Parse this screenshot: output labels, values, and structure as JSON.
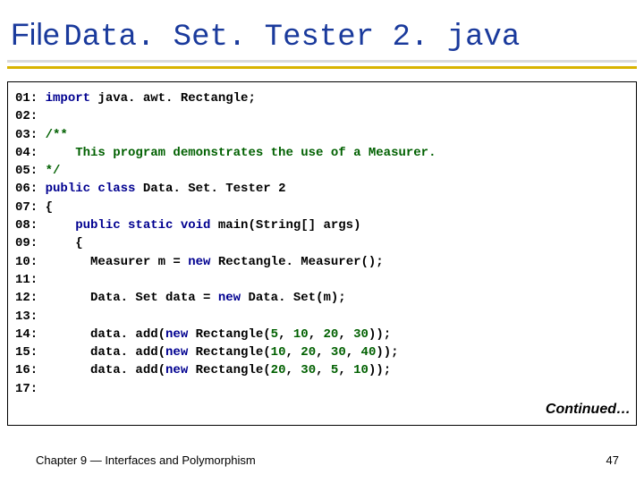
{
  "title": {
    "prefix": "File",
    "filename": " Data. Set. Tester 2. java"
  },
  "code": {
    "lines": [
      {
        "ln": "01:",
        "tokens": [
          {
            "cls": "tok-kw",
            "t": "import"
          },
          {
            "cls": "tok-plain",
            "t": " java. awt. Rectangle;"
          }
        ]
      },
      {
        "ln": "02:",
        "tokens": []
      },
      {
        "ln": "03:",
        "tokens": [
          {
            "cls": "tok-comment",
            "t": "/**"
          }
        ]
      },
      {
        "ln": "04:",
        "tokens": [
          {
            "cls": "tok-comment",
            "t": "    This program demonstrates the use of a Measurer."
          }
        ]
      },
      {
        "ln": "05:",
        "tokens": [
          {
            "cls": "tok-comment",
            "t": "*/"
          }
        ]
      },
      {
        "ln": "06:",
        "tokens": [
          {
            "cls": "tok-kw",
            "t": "public class"
          },
          {
            "cls": "tok-plain",
            "t": " Data. Set. Tester 2"
          }
        ]
      },
      {
        "ln": "07:",
        "tokens": [
          {
            "cls": "tok-plain",
            "t": "{"
          }
        ]
      },
      {
        "ln": "08:",
        "tokens": [
          {
            "cls": "tok-plain",
            "t": "    "
          },
          {
            "cls": "tok-kw",
            "t": "public static void"
          },
          {
            "cls": "tok-plain",
            "t": " main(String[] args)"
          }
        ]
      },
      {
        "ln": "09:",
        "tokens": [
          {
            "cls": "tok-plain",
            "t": "    {"
          }
        ]
      },
      {
        "ln": "10:",
        "tokens": [
          {
            "cls": "tok-plain",
            "t": "      Measurer m = "
          },
          {
            "cls": "tok-kw",
            "t": "new"
          },
          {
            "cls": "tok-plain",
            "t": " Rectangle. Measurer();"
          }
        ]
      },
      {
        "ln": "11:",
        "tokens": []
      },
      {
        "ln": "12:",
        "tokens": [
          {
            "cls": "tok-plain",
            "t": "      Data. Set data = "
          },
          {
            "cls": "tok-kw",
            "t": "new"
          },
          {
            "cls": "tok-plain",
            "t": " Data. Set(m);"
          }
        ]
      },
      {
        "ln": "13:",
        "tokens": []
      },
      {
        "ln": "14:",
        "tokens": [
          {
            "cls": "tok-plain",
            "t": "      data. add("
          },
          {
            "cls": "tok-kw",
            "t": "new"
          },
          {
            "cls": "tok-plain",
            "t": " Rectangle("
          },
          {
            "cls": "tok-num",
            "t": "5"
          },
          {
            "cls": "tok-plain",
            "t": ", "
          },
          {
            "cls": "tok-num",
            "t": "10"
          },
          {
            "cls": "tok-plain",
            "t": ", "
          },
          {
            "cls": "tok-num",
            "t": "20"
          },
          {
            "cls": "tok-plain",
            "t": ", "
          },
          {
            "cls": "tok-num",
            "t": "30"
          },
          {
            "cls": "tok-plain",
            "t": "));"
          }
        ]
      },
      {
        "ln": "15:",
        "tokens": [
          {
            "cls": "tok-plain",
            "t": "      data. add("
          },
          {
            "cls": "tok-kw",
            "t": "new"
          },
          {
            "cls": "tok-plain",
            "t": " Rectangle("
          },
          {
            "cls": "tok-num",
            "t": "10"
          },
          {
            "cls": "tok-plain",
            "t": ", "
          },
          {
            "cls": "tok-num",
            "t": "20"
          },
          {
            "cls": "tok-plain",
            "t": ", "
          },
          {
            "cls": "tok-num",
            "t": "30"
          },
          {
            "cls": "tok-plain",
            "t": ", "
          },
          {
            "cls": "tok-num",
            "t": "40"
          },
          {
            "cls": "tok-plain",
            "t": "));"
          }
        ]
      },
      {
        "ln": "16:",
        "tokens": [
          {
            "cls": "tok-plain",
            "t": "      data. add("
          },
          {
            "cls": "tok-kw",
            "t": "new"
          },
          {
            "cls": "tok-plain",
            "t": " Rectangle("
          },
          {
            "cls": "tok-num",
            "t": "20"
          },
          {
            "cls": "tok-plain",
            "t": ", "
          },
          {
            "cls": "tok-num",
            "t": "30"
          },
          {
            "cls": "tok-plain",
            "t": ", "
          },
          {
            "cls": "tok-num",
            "t": "5"
          },
          {
            "cls": "tok-plain",
            "t": ", "
          },
          {
            "cls": "tok-num",
            "t": "10"
          },
          {
            "cls": "tok-plain",
            "t": "));"
          }
        ]
      },
      {
        "ln": "17:",
        "tokens": []
      }
    ]
  },
  "continued": "Continued…",
  "footer": {
    "chapter": "Chapter 9 — Interfaces and Polymorphism",
    "page": "47"
  }
}
